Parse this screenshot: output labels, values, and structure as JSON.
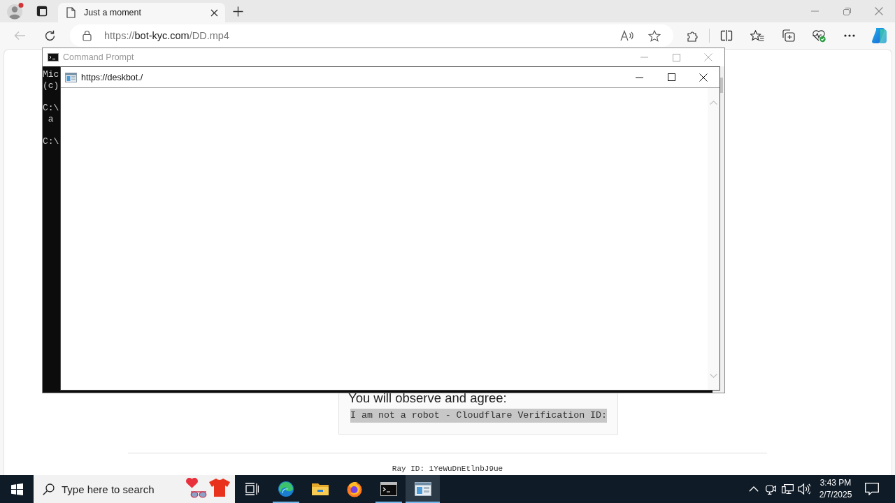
{
  "browser": {
    "profile": {
      "notification": true
    },
    "tabs": [
      {
        "title": "Just a moment",
        "selected": true
      }
    ],
    "back": {
      "disabled": true
    },
    "address": "https://**bot-kyc.com**/DD.mp4"
  },
  "page": {
    "heading": "You will observe and agree:",
    "verification_text": "I am not a robot - Cloudflare Verification ID:",
    "ray_id": "Ray ID: 1YeWuDnEtlnbJ9ue"
  },
  "cmd_window": {
    "title": "Command Prompt",
    "active": false,
    "paragraphs": [
      [
        "Mic",
        "(c)"
      ],
      [
        "C:\\",
        " a"
      ],
      [
        "C:\\"
      ]
    ]
  },
  "popup_window": {
    "title": "https://deskbot./",
    "active": true
  },
  "taskbar": {
    "search_placeholder": "Type here to search",
    "apps": [
      {
        "kind": "edge",
        "running": true,
        "selected": false
      },
      {
        "kind": "explorer",
        "running": false,
        "selected": false
      },
      {
        "kind": "firefox",
        "running": false,
        "selected": false
      },
      {
        "kind": "terminal",
        "running": true,
        "selected": false
      },
      {
        "kind": "window",
        "running": true,
        "selected": true
      }
    ],
    "time": "3:43 PM",
    "date": "2/7/2025"
  }
}
